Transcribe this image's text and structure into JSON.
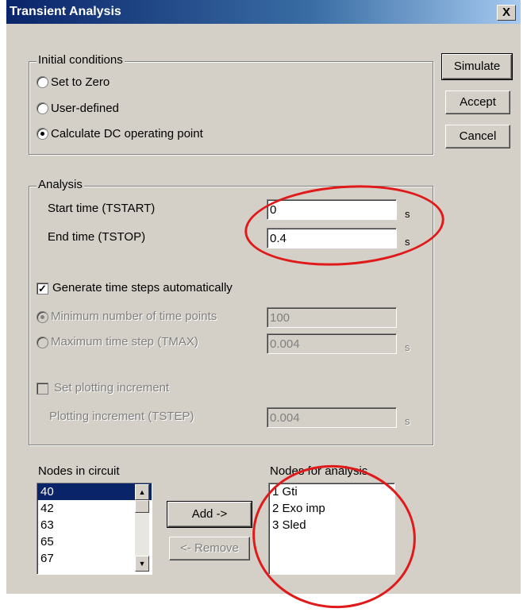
{
  "dialog": {
    "title": "Transient Analysis",
    "close_label": "X"
  },
  "buttons": {
    "simulate": "Simulate",
    "accept": "Accept",
    "cancel": "Cancel"
  },
  "initial_conditions": {
    "legend": "Initial conditions",
    "options": [
      "Set to Zero",
      "User-defined",
      "Calculate DC operating point"
    ],
    "selected": "Calculate DC operating point"
  },
  "analysis": {
    "legend": "Analysis",
    "start_time_label": "Start time (TSTART)",
    "start_time_value": "0",
    "start_time_unit": "s",
    "end_time_label": "End time (TSTOP)",
    "end_time_value": "0.4",
    "end_time_unit": "s",
    "auto_steps_label": "Generate time steps automatically",
    "auto_steps_checked": true,
    "min_points_label": "Minimum number of time points",
    "min_points_value": "100",
    "max_step_label": "Maximum time step (TMAX)",
    "max_step_value": "0.004",
    "max_step_unit": "s",
    "plot_incr_check_label": "Set plotting increment",
    "plot_incr_label": "Plotting increment (TSTEP)",
    "plot_incr_value": "0.004",
    "plot_incr_unit": "s"
  },
  "nodes": {
    "circuit_label": "Nodes in circuit",
    "circuit_items": [
      "40",
      "42",
      "63",
      "65",
      "67"
    ],
    "selected_item": "40",
    "add_label": "Add ->",
    "remove_label": "<- Remove",
    "analysis_label": "Nodes for analysis",
    "analysis_items": [
      "1 Gti",
      "2 Exo imp",
      "3 Sled"
    ]
  },
  "colors": {
    "title_bar": "#0a246a",
    "dialog_bg": "#d4d0c8",
    "annotation": "#e01a1a",
    "selection": "#0a246a"
  }
}
